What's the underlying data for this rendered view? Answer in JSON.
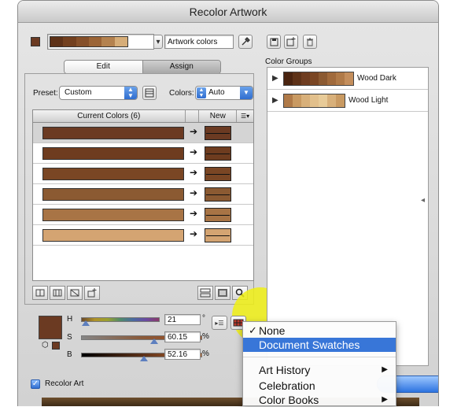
{
  "window": {
    "title": "Recolor Artwork"
  },
  "top": {
    "artwork_colors_value": "Artwork colors",
    "strip_colors": [
      "#5e3218",
      "#73401f",
      "#86502a",
      "#9b6436",
      "#b4824f",
      "#d6ad78"
    ],
    "selected_swatch_color": "#6b3a22"
  },
  "tabs": {
    "edit": "Edit",
    "assign": "Assign"
  },
  "preset": {
    "label": "Preset:",
    "value": "Custom"
  },
  "colors": {
    "label": "Colors:",
    "value": "Auto"
  },
  "table": {
    "header_current": "Current Colors (6)",
    "header_new": "New",
    "rows": [
      {
        "current": "#6b3a22",
        "new": "#6b3a22",
        "selected": true
      },
      {
        "current": "#6e3c1f",
        "new": "#6e3c1f",
        "selected": false
      },
      {
        "current": "#7a4624",
        "new": "#7a4624",
        "selected": false
      },
      {
        "current": "#8b5a32",
        "new": "#8b5a32",
        "selected": false
      },
      {
        "current": "#a87445",
        "new": "#a87445",
        "selected": false
      },
      {
        "current": "#d4a472",
        "new": "#d4a472",
        "selected": false
      }
    ]
  },
  "sliders": {
    "h": {
      "label": "H",
      "value": "21",
      "unit": "°",
      "level": 0.06
    },
    "s": {
      "label": "S",
      "value": "60.15",
      "unit": "%",
      "level": 0.6015
    },
    "b": {
      "label": "B",
      "value": "52.16",
      "unit": "%",
      "level": 0.5216
    }
  },
  "color_groups": {
    "label": "Color Groups",
    "groups": [
      {
        "name": "Wood Dark",
        "colors": [
          "#4a2410",
          "#5e3218",
          "#6e3c20",
          "#7a4624",
          "#8b5a32",
          "#a06a3c",
          "#b07a48",
          "#c48e5c"
        ]
      },
      {
        "name": "Wood Light",
        "colors": [
          "#b07a48",
          "#c99a62",
          "#d8b07a",
          "#e2c08c",
          "#e8cb98",
          "#d8b07a",
          "#c99a62"
        ]
      }
    ]
  },
  "recolor_art": {
    "label": "Recolor Art"
  },
  "menu": {
    "items": [
      {
        "label": "None",
        "checked": true,
        "submenu": false,
        "highlighted": false
      },
      {
        "label": "Document Swatches",
        "checked": false,
        "submenu": false,
        "highlighted": true
      },
      {
        "label": "Art History",
        "checked": false,
        "submenu": true,
        "highlighted": false
      },
      {
        "label": "Celebration",
        "checked": false,
        "submenu": false,
        "highlighted": false
      },
      {
        "label": "Color Books",
        "checked": false,
        "submenu": true,
        "highlighted": false
      }
    ]
  }
}
